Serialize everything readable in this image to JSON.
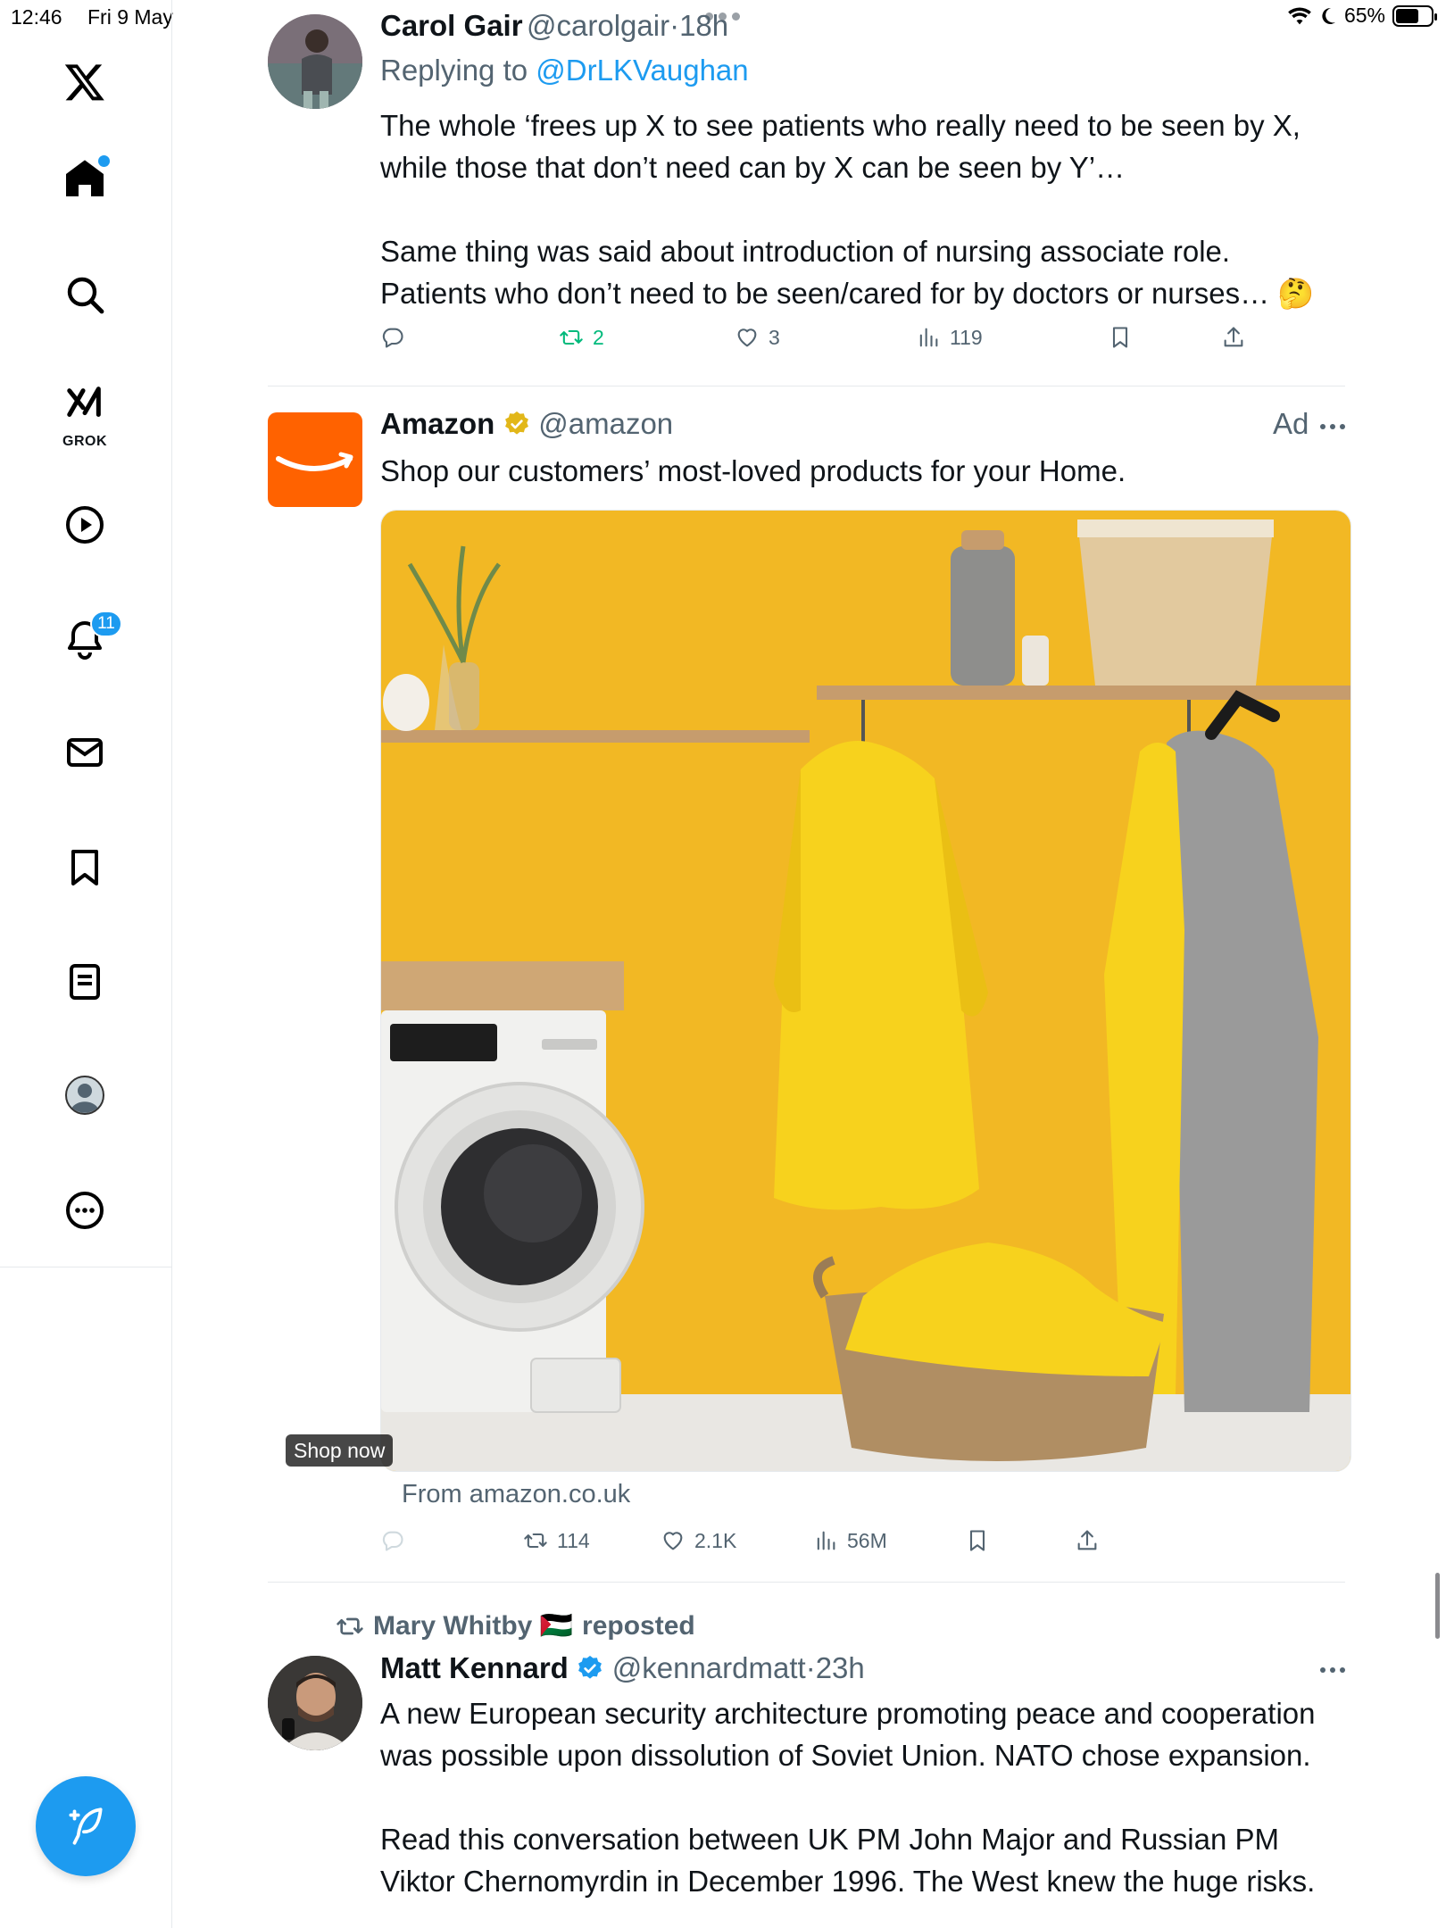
{
  "status_bar": {
    "time": "12:46",
    "date": "Fri 9 May",
    "battery": "65%"
  },
  "sidebar": {
    "logo": "x-logo-icon",
    "items": [
      {
        "name": "home",
        "icon": "home-icon"
      },
      {
        "name": "search",
        "icon": "search-icon"
      },
      {
        "name": "grok",
        "icon": "grok-icon",
        "label": "GROK"
      },
      {
        "name": "video",
        "icon": "play-icon"
      },
      {
        "name": "notifications",
        "icon": "bell-icon",
        "badge": "11"
      },
      {
        "name": "messages",
        "icon": "mail-icon"
      },
      {
        "name": "bookmarks",
        "icon": "bookmark-icon"
      },
      {
        "name": "lists",
        "icon": "list-icon"
      },
      {
        "name": "profile",
        "icon": "avatar-icon"
      },
      {
        "name": "more",
        "icon": "more-icon"
      }
    ],
    "compose_icon": "compose-icon",
    "accent": "#1d9bf0"
  },
  "tweets": [
    {
      "name": "Carol Gair",
      "handle": "@carolgair",
      "separator": "·",
      "time": "18h",
      "replying_prefix": "Replying to ",
      "replying_to": "@DrLKVaughan",
      "text": "The whole ‘frees up X to see patients who really need to be seen by X, while those that don’t need can by X can be seen by Y’…\n\nSame thing was said about introduction of nursing associate role. Patients who don’t need to be seen/cared for by doctors or nurses… 🤔",
      "retweets": "2",
      "likes": "3",
      "views": "119"
    },
    {
      "name": "Amazon",
      "handle": "@amazon",
      "ad_label": "Ad",
      "text": "Shop our customers’ most-loved products for your Home.",
      "cta": "Shop now",
      "source": "From amazon.co.uk",
      "retweets": "114",
      "likes": "2.1K",
      "views": "56M"
    },
    {
      "repost_by": "Mary Whitby 🇵🇸",
      "repost_label": "reposted",
      "name": "Matt Kennard",
      "handle": "@kennardmatt",
      "separator": "·",
      "time": "23h",
      "text": "A new European security architecture promoting peace and cooperation was possible upon dissolution of Soviet Union. NATO chose expansion.\n\nRead this conversation between UK PM John Major and Russian PM Viktor Chernomyrdin in December 1996. The West knew the huge risks."
    }
  ],
  "colors": {
    "secondary_text": "#536471",
    "retweet_green": "#00ba7c",
    "link": "#1d9bf0",
    "amazon_orange": "#ff6200",
    "ad_wall": "#f2b824"
  }
}
